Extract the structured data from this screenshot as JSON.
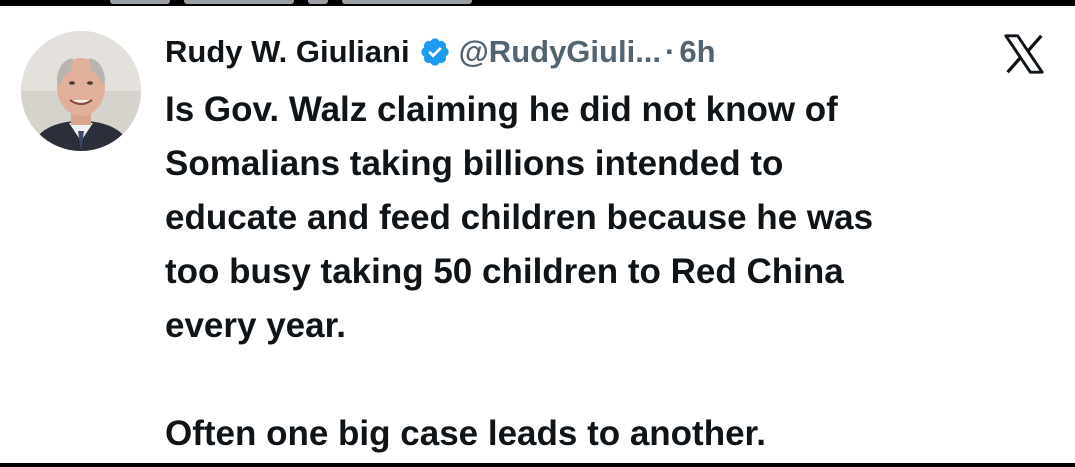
{
  "tweet": {
    "author": {
      "display_name": "Rudy W. Giuliani",
      "handle": "@RudyGiuli...",
      "verified": true,
      "verified_color": "#1d9bf0",
      "avatar_icon": "profile-photo"
    },
    "separator": "·",
    "timestamp": "6h",
    "platform_icon": "x-logo-icon",
    "paragraphs": [
      "Is Gov. Walz claiming he did not know of\nSomalians taking billions intended to\neducate and feed children because he was\ntoo busy taking 50 children to Red China\nevery year.",
      "Often one big case leads to another."
    ]
  },
  "colors": {
    "text_primary": "#0f1419",
    "text_secondary": "#536471",
    "background": "#ffffff"
  }
}
